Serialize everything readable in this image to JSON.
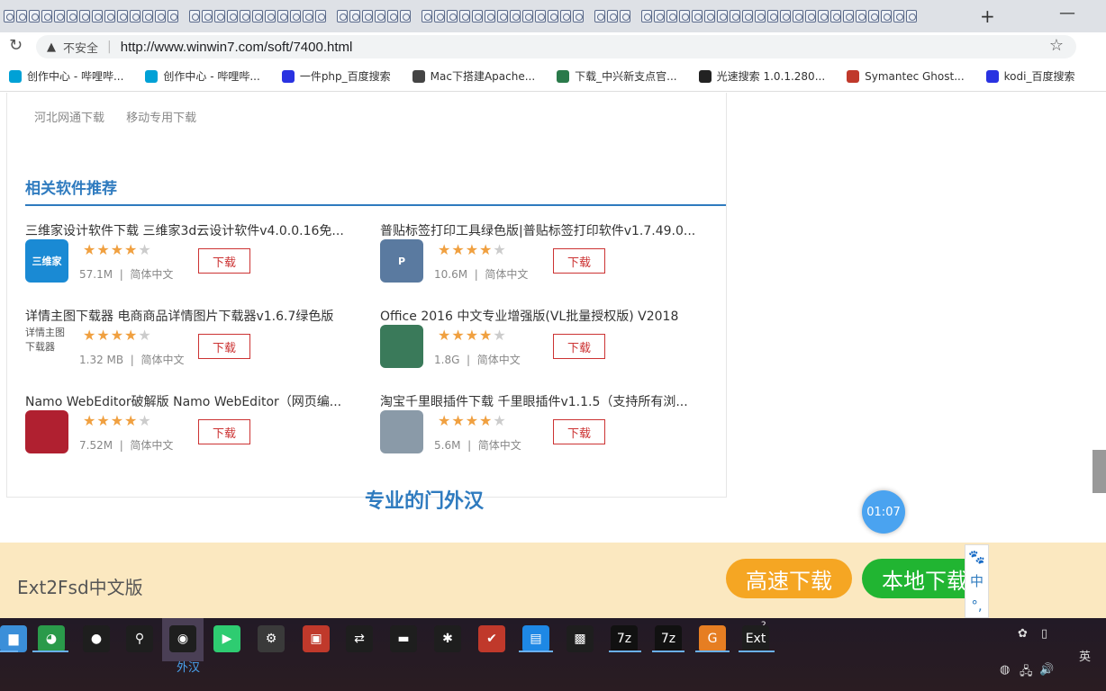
{
  "browser": {
    "url_security": "不安全",
    "url": "http://www.winwin7.com/soft/7400.html",
    "new_tab": "+",
    "minimize": "—"
  },
  "bookmarks": [
    {
      "label": "创作中心 - 哔哩哔...",
      "icon": "bilibili-icon",
      "color": "#00a1d6"
    },
    {
      "label": "创作中心 - 哔哩哔...",
      "icon": "bilibili-icon",
      "color": "#00a1d6"
    },
    {
      "label": "一件php_百度搜索",
      "icon": "baidu-icon",
      "color": "#2932e1"
    },
    {
      "label": "Mac下搭建Apache...",
      "icon": "pen-icon",
      "color": "#444444"
    },
    {
      "label": "下载_中兴新支点官...",
      "icon": "zte-icon",
      "color": "#2a7a4a"
    },
    {
      "label": "光速搜索 1.0.1.280...",
      "icon": "runner-icon",
      "color": "#222222"
    },
    {
      "label": "Symantec Ghost...",
      "icon": "ghost-icon",
      "color": "#c0392b"
    },
    {
      "label": "kodi_百度搜索",
      "icon": "baidu-icon",
      "color": "#2932e1"
    }
  ],
  "mirrors": [
    "河北网通下载",
    "移动专用下载"
  ],
  "section_title": "相关软件推荐",
  "items": [
    {
      "name": "三维家设计软件下载 三维家3d云设计软件v4.0.0.16免...",
      "size": "57.1M",
      "lang": "简体中文",
      "rating": 4,
      "download": "下载",
      "img_text": "三维家",
      "img_color": "#1a8ad4"
    },
    {
      "name": "普贴标签打印工具绿色版|普贴标签打印软件v1.7.49.0...",
      "size": "10.6M",
      "lang": "简体中文",
      "rating": 4,
      "download": "下载",
      "img_text": "P",
      "img_color": "#5a7aa0"
    },
    {
      "name": "详情主图下载器 电商商品详情图片下载器v1.6.7绿色版",
      "size": "1.32 MB",
      "lang": "简体中文",
      "rating": 4,
      "download": "下载",
      "img_text": "详情主图下载器",
      "img_color": "#ffffff"
    },
    {
      "name": "Office 2016 中文专业增强版(VL批量授权版) V2018",
      "size": "1.8G",
      "lang": "简体中文",
      "rating": 4,
      "download": "下载",
      "img_text": "",
      "img_color": "#3a7a5a"
    },
    {
      "name": "Namo WebEditor破解版 Namo WebEditor（网页编...",
      "size": "7.52M",
      "lang": "简体中文",
      "rating": 4,
      "download": "下载",
      "img_text": "",
      "img_color": "#b02030"
    },
    {
      "name": "淘宝千里眼插件下载 千里眼插件v1.1.5（支持所有浏...",
      "size": "5.6M",
      "lang": "简体中文",
      "rating": 4,
      "download": "下载",
      "img_text": "",
      "img_color": "#8a9aa8"
    }
  ],
  "slogan": "专业的门外汉",
  "timer": "01:07",
  "bottom": {
    "title": "Ext2Fsd中文版",
    "fast_download": "高速下载",
    "local_download": "本地下载"
  },
  "ime": {
    "zh": "中",
    "punct": "°,"
  },
  "taskbar": {
    "hover_label": "外汉",
    "tray_lang": "英",
    "badge": "2"
  }
}
